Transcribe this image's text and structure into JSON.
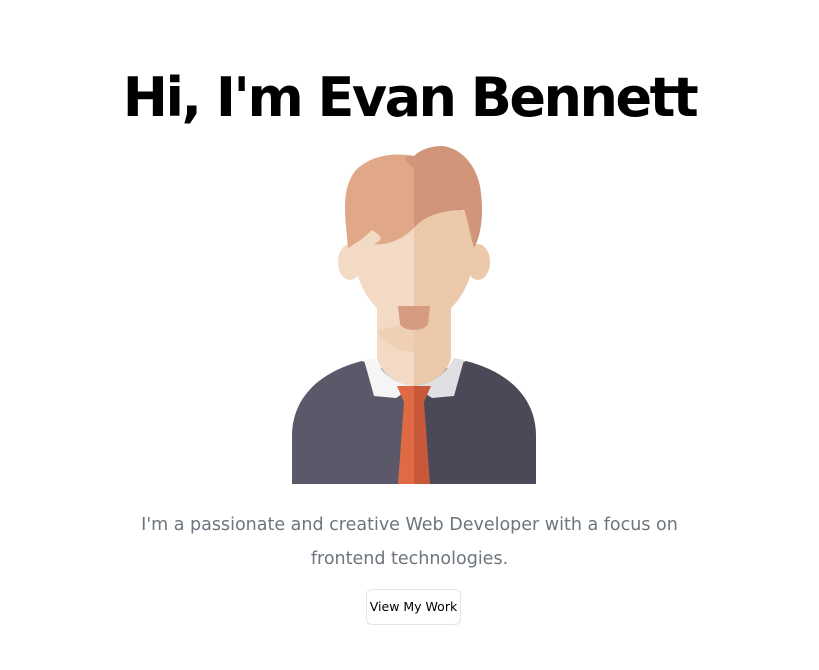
{
  "hero": {
    "title": "Hi, I'm Evan Bennett",
    "description": "I'm a passionate and creative Web Developer with a focus on frontend technologies.",
    "cta_label": "View My Work"
  },
  "avatar": {
    "icon": "developer-avatar-illustration"
  },
  "colors": {
    "title_text": "#000000",
    "description_text": "#6c757d",
    "button_border": "#e4e4e4",
    "hair_light": "#e0a788",
    "hair_dark": "#d1957a",
    "skin_light": "#f3dac4",
    "skin_dark": "#ecc9ab",
    "beard": "#d59c80",
    "shirt_light": "#5a5869",
    "shirt_dark": "#4b4958",
    "collar_light": "#f5f5f5",
    "collar_dark": "#e0dfe3",
    "tie_light": "#e06a43",
    "tie_dark": "#c9583a"
  }
}
